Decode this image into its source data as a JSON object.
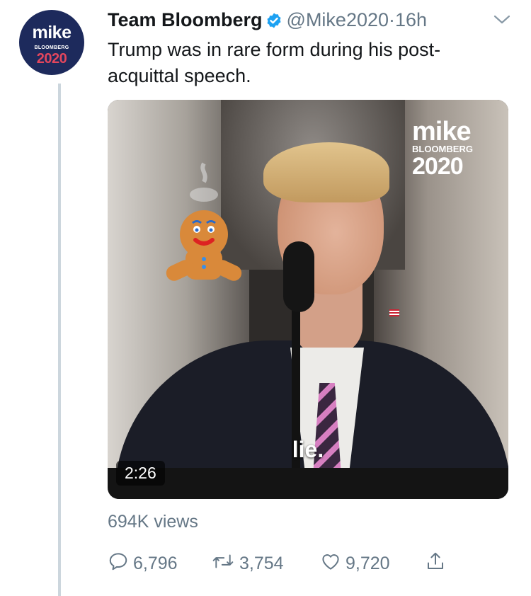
{
  "author": {
    "name": "Team Bloomberg",
    "handle": "@Mike2020",
    "separator": "·",
    "time": "16h",
    "avatar": {
      "line1": "mike",
      "line2": "BLOOMBERG",
      "line3": "2020"
    }
  },
  "tweet": {
    "text": "Trump was in rare form during his post-acquittal speech."
  },
  "media": {
    "watermark": {
      "line1": "mike",
      "line2": "BLOOMBERG",
      "line3": "2020"
    },
    "caption": "lie.",
    "duration": "2:26"
  },
  "stats": {
    "views": "694K views",
    "replies": "6,796",
    "retweets": "3,754",
    "likes": "9,720"
  },
  "icons": [
    "verified-icon",
    "chevron-down-icon",
    "reply-icon",
    "retweet-icon",
    "like-icon",
    "share-icon"
  ],
  "colors": {
    "accent": "#1da1f2",
    "secondary_text": "#657786",
    "avatar_bg": "#1d2a5c",
    "avatar_year": "#e3465d"
  }
}
